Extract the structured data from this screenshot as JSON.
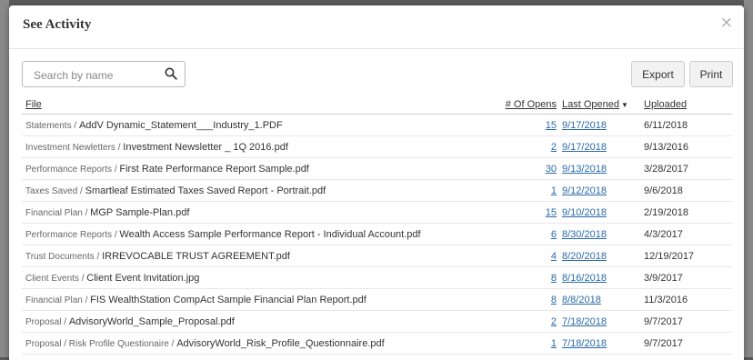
{
  "modal": {
    "title": "See Activity",
    "close_label": "×"
  },
  "search": {
    "placeholder": "Search by name",
    "value": ""
  },
  "toolbar": {
    "export_label": "Export",
    "print_label": "Print"
  },
  "table": {
    "columns": {
      "file": "File",
      "opens": "# Of Opens",
      "last_opened": "Last Opened",
      "uploaded": "Uploaded"
    },
    "sort_indicator": "▼",
    "rows": [
      {
        "category": "Statements",
        "name": "AddV Dynamic_Statement___Industry_1.PDF",
        "opens": "15",
        "last_opened": "9/17/2018",
        "uploaded": "6/11/2018"
      },
      {
        "category": "Investment Newletters",
        "name": "Investment Newsletter _ 1Q 2016.pdf",
        "opens": "2",
        "last_opened": "9/17/2018",
        "uploaded": "9/13/2016"
      },
      {
        "category": "Performance Reports",
        "name": "First Rate Performance Report Sample.pdf",
        "opens": "30",
        "last_opened": "9/13/2018",
        "uploaded": "3/28/2017"
      },
      {
        "category": "Taxes Saved",
        "name": "Smartleaf Estimated Taxes Saved Report - Portrait.pdf",
        "opens": "1",
        "last_opened": "9/12/2018",
        "uploaded": "9/6/2018"
      },
      {
        "category": "Financial Plan",
        "name": "MGP Sample-Plan.pdf",
        "opens": "15",
        "last_opened": "9/10/2018",
        "uploaded": "2/19/2018"
      },
      {
        "category": "Performance Reports",
        "name": "Wealth Access Sample Performance Report - Individual Account.pdf",
        "opens": "6",
        "last_opened": "8/30/2018",
        "uploaded": "4/3/2017"
      },
      {
        "category": "Trust Documents",
        "name": "IRREVOCABLE TRUST AGREEMENT.pdf",
        "opens": "4",
        "last_opened": "8/20/2018",
        "uploaded": "12/19/2017"
      },
      {
        "category": "Client Events",
        "name": "Client Event Invitation.jpg",
        "opens": "8",
        "last_opened": "8/16/2018",
        "uploaded": "3/9/2017"
      },
      {
        "category": "Financial Plan",
        "name": "FIS WealthStation CompAct Sample Financial Plan Report.pdf",
        "opens": "8",
        "last_opened": "8/8/2018",
        "uploaded": "11/3/2016"
      },
      {
        "category": "Proposal",
        "name": "AdvisoryWorld_Sample_Proposal.pdf",
        "opens": "2",
        "last_opened": "7/18/2018",
        "uploaded": "9/7/2017"
      },
      {
        "category": "Proposal / Risk Profile Questionaire",
        "name": "AdvisoryWorld_Risk_Profile_Questionnaire.pdf",
        "opens": "1",
        "last_opened": "7/18/2018",
        "uploaded": "9/7/2017"
      }
    ]
  },
  "colors": {
    "link": "#2a6aa8",
    "backdrop": "#5a5a5a"
  },
  "icons": {
    "search": "search-icon",
    "close": "close-icon"
  }
}
